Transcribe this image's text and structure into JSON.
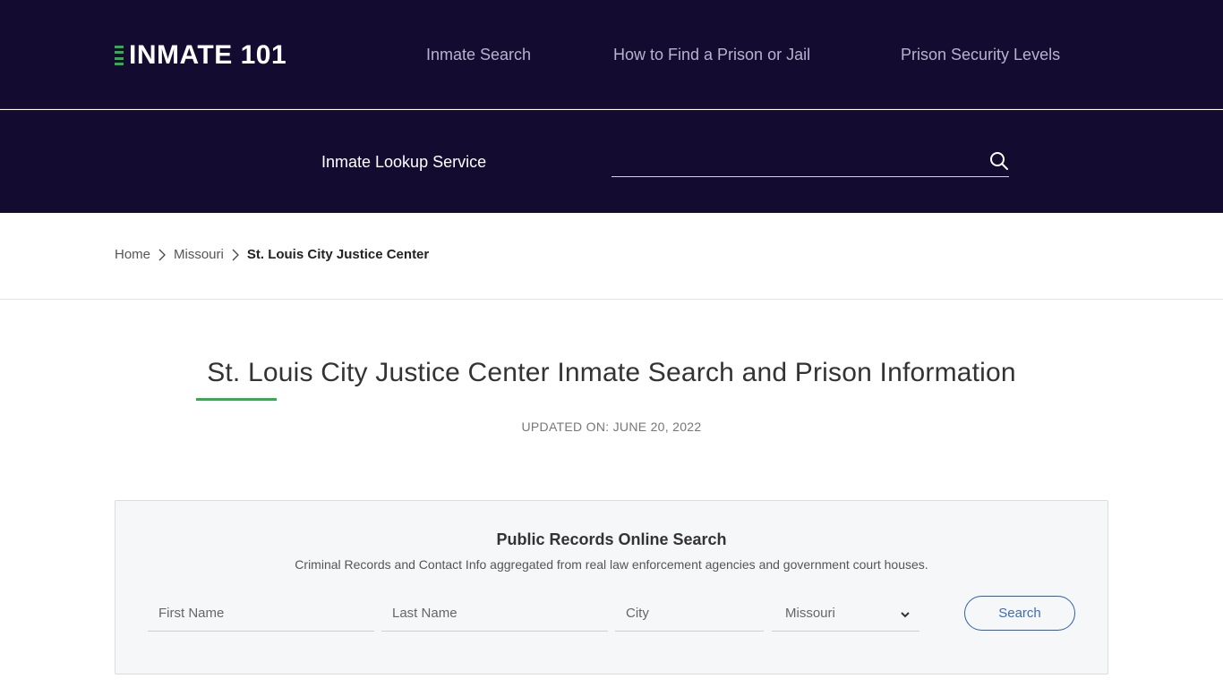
{
  "header": {
    "logo_text": "INMATE 101",
    "nav": [
      {
        "label": "Inmate Search"
      },
      {
        "label": "How to Find a Prison or Jail"
      },
      {
        "label": "Prison Security Levels"
      }
    ]
  },
  "lookup": {
    "label": "Inmate Lookup Service",
    "placeholder": "",
    "value": "",
    "icon": "search-icon"
  },
  "breadcrumb": {
    "items": [
      {
        "label": "Home"
      },
      {
        "label": "Missouri"
      }
    ],
    "current": "St. Louis City Justice Center"
  },
  "main": {
    "title": "St. Louis City Justice Center Inmate Search and Prison Information",
    "updated": "UPDATED ON: JUNE 20, 2022"
  },
  "records": {
    "title": "Public Records Online Search",
    "subtitle": "Criminal Records and Contact Info aggregated from real law enforcement agencies and government court houses.",
    "fields": {
      "first_name_placeholder": "First Name",
      "last_name_placeholder": "Last Name",
      "city_placeholder": "City"
    },
    "state_selected": "Missouri",
    "search_label": "Search"
  },
  "colors": {
    "header_bg": "#140c30",
    "accent_green": "#2bb34a",
    "button_blue": "#2f5fa8"
  }
}
